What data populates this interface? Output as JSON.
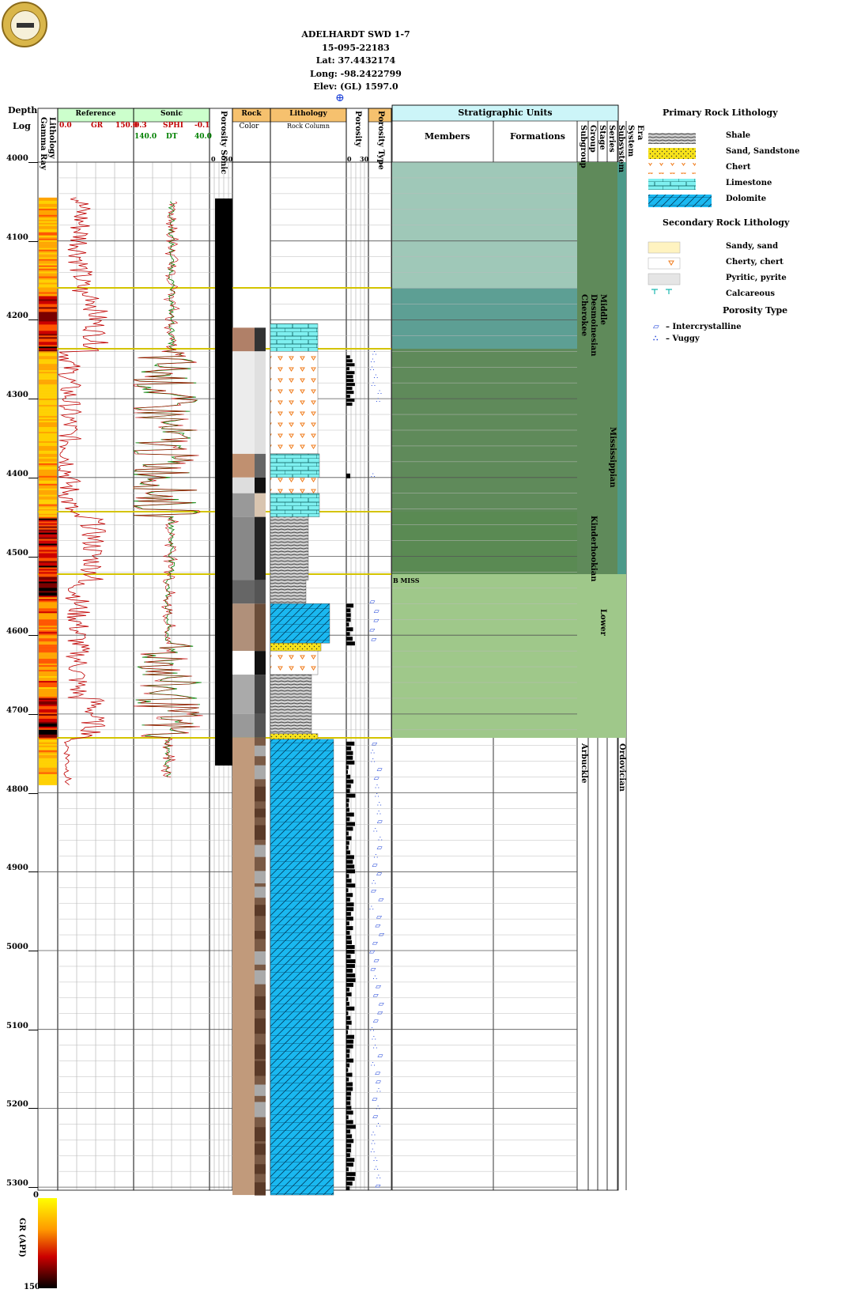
{
  "header": {
    "well_name": "ADELHARDT SWD 1-7",
    "api": "15-095-22183",
    "lat": "Lat: 37.4432174",
    "long": "Long: -98.2422799",
    "elev": "Elev: (GL) 1597.0"
  },
  "tracks": {
    "depth_log": [
      "Depth",
      "Log"
    ],
    "lithology": "Lithology",
    "gamma_ray": "Gamma Ray",
    "reference": {
      "title": "Reference",
      "min": "0.0",
      "curve": "GR",
      "max": "150.0"
    },
    "sonic": {
      "title": "Sonic",
      "sphi_min": "0.3",
      "sphi": "SPHI",
      "sphi_max": "-0.1",
      "dt_min": "140.0",
      "dt": "DT",
      "dt_max": "40.0"
    },
    "porosity_sonic": "Porosity Sonic",
    "porosity_sonic_scale": [
      "0",
      "50"
    ],
    "rock": [
      "Rock",
      "Color"
    ],
    "lithology_track": [
      "Lithology",
      "Rock Column"
    ],
    "porosity": "Porosity",
    "porosity_scale": [
      "0",
      "30"
    ],
    "porosity_type": "Porosity Type",
    "strat_title": "Stratigraphic Units",
    "members": "Members",
    "formations": "Formations",
    "strat_cols": [
      "Subgroup",
      "Group",
      "Stage",
      "Series",
      "Subsystem",
      "System",
      "Era"
    ]
  },
  "depths": [
    "4000",
    "4100",
    "4200",
    "4300",
    "4400",
    "4500",
    "4600",
    "4700",
    "4800",
    "4900",
    "5000",
    "5100",
    "5200",
    "5300"
  ],
  "strat_labels": {
    "cherokee": "Cherokee",
    "desmoinesian": "Desmoinesian",
    "middle": "Middle",
    "mississippian": "Mississippian",
    "kinderhookian": "Kinderhookian",
    "lower": "Lower",
    "arbuckle": "Arbuckle",
    "ordovician": "Ordovician",
    "b_miss": "B MISS"
  },
  "legend": {
    "primary_title": "Primary Rock Lithology",
    "primary": [
      "Shale",
      "Sand, Sandstone",
      "Chert",
      "Limestone",
      "Dolomite"
    ],
    "secondary_title": "Secondary Rock Lithology",
    "secondary": [
      "Sandy, sand",
      "Cherty, chert",
      "Pyritic, pyrite",
      "Calcareous"
    ],
    "porosity_type_title": "Porosity Type",
    "porosity_types": [
      "Intercrystalline",
      "Vuggy"
    ]
  },
  "gr_scale": {
    "title": "GR (API)",
    "min": "0",
    "max": "150"
  },
  "colors": {
    "reference_header": "#ccffcc",
    "rock_header": "#f6c16e",
    "strat_header": "#ccf5f8",
    "gr_curve": "#c00000",
    "dt_curve": "#008000",
    "dolomite": "#1ab8f0",
    "limestone": "#7ff0f0",
    "sand": "#f7e21a",
    "chert": "#f6a23c",
    "shale": "#555555",
    "strat_miss_upper": "#9fc8b8",
    "strat_cherokee": "#5d9f94",
    "strat_miss": "#5f8a5a",
    "strat_kinder": "#5a8a53",
    "strat_lower": "#9fc88a",
    "strat_bar": "#4c9a8a"
  }
}
